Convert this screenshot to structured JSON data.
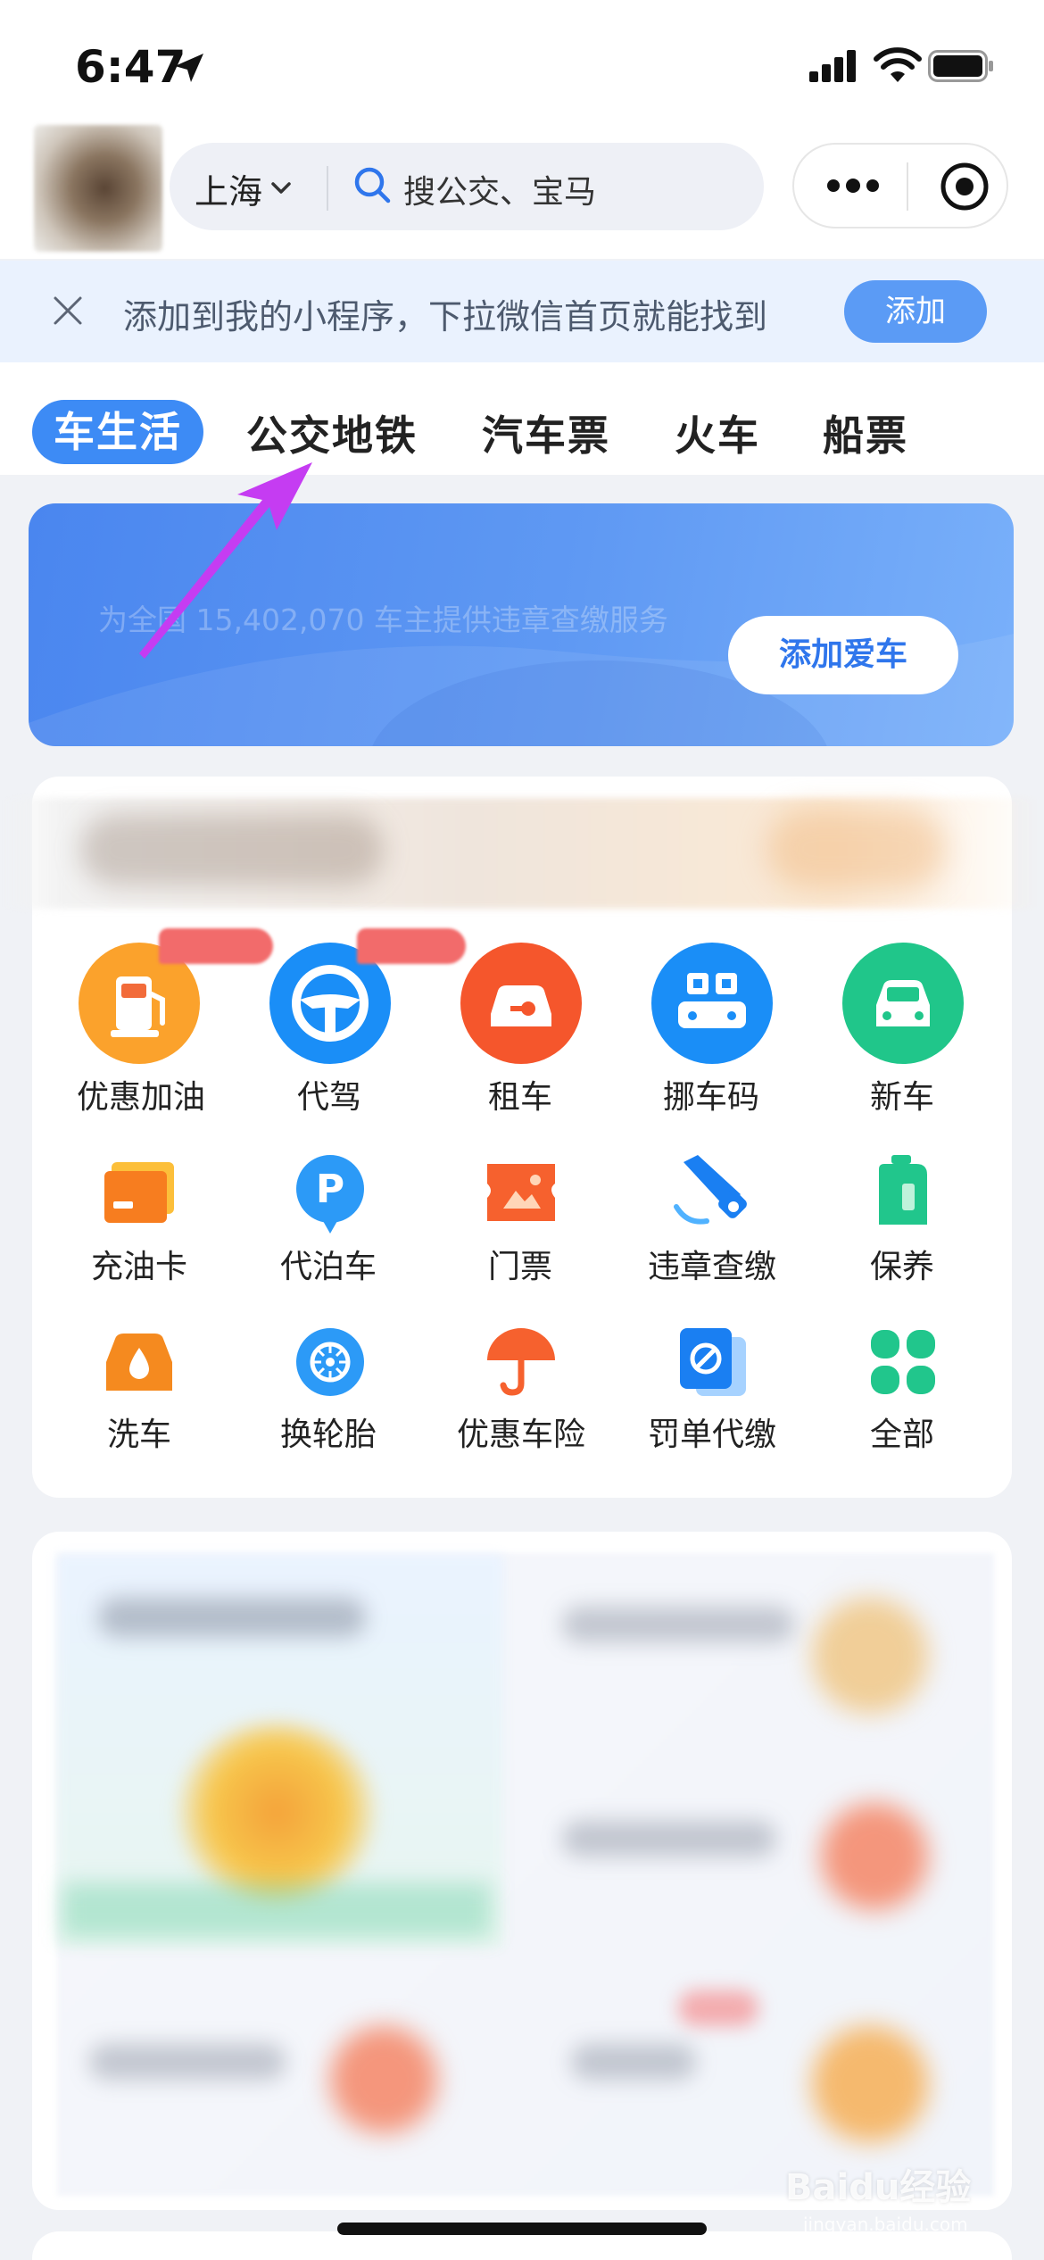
{
  "status_bar": {
    "time": "6:47"
  },
  "header": {
    "city": "上海",
    "search_placeholder": "搜公交、宝马"
  },
  "add_banner": {
    "text": "添加到我的小程序，下拉微信首页就能找到",
    "button": "添加"
  },
  "tabs": [
    {
      "label": "车生活",
      "active": true
    },
    {
      "label": "公交地铁",
      "active": false
    },
    {
      "label": "汽车票",
      "active": false
    },
    {
      "label": "火车",
      "active": false
    },
    {
      "label": "船票",
      "active": false
    }
  ],
  "car_banner": {
    "text": "为全国 15,402,070 车主提供违章查缴服务",
    "button": "添加爱车"
  },
  "services_row1": [
    {
      "label": "优惠加油",
      "icon": "gas-pump-icon"
    },
    {
      "label": "代驾",
      "icon": "steering-wheel-icon"
    },
    {
      "label": "租车",
      "icon": "car-key-icon"
    },
    {
      "label": "挪车码",
      "icon": "qr-car-icon"
    },
    {
      "label": "新车",
      "icon": "new-car-icon"
    }
  ],
  "services_row2": [
    {
      "label": "充油卡",
      "icon": "fuel-card-icon"
    },
    {
      "label": "代泊车",
      "icon": "parking-icon"
    },
    {
      "label": "门票",
      "icon": "ticket-icon"
    },
    {
      "label": "违章查缴",
      "icon": "camera-icon"
    },
    {
      "label": "保养",
      "icon": "oil-bottle-icon"
    }
  ],
  "services_row3": [
    {
      "label": "洗车",
      "icon": "car-wash-icon"
    },
    {
      "label": "换轮胎",
      "icon": "tire-icon"
    },
    {
      "label": "优惠车险",
      "icon": "umbrella-icon"
    },
    {
      "label": "罚单代缴",
      "icon": "ticket-fine-icon"
    },
    {
      "label": "全部",
      "icon": "grid-icon"
    }
  ],
  "colors": {
    "accent": "#3d8bf5",
    "banner": "#4a86ef"
  },
  "watermark": {
    "brand": "Baidu经验",
    "url": "jingyan.baidu.com"
  }
}
